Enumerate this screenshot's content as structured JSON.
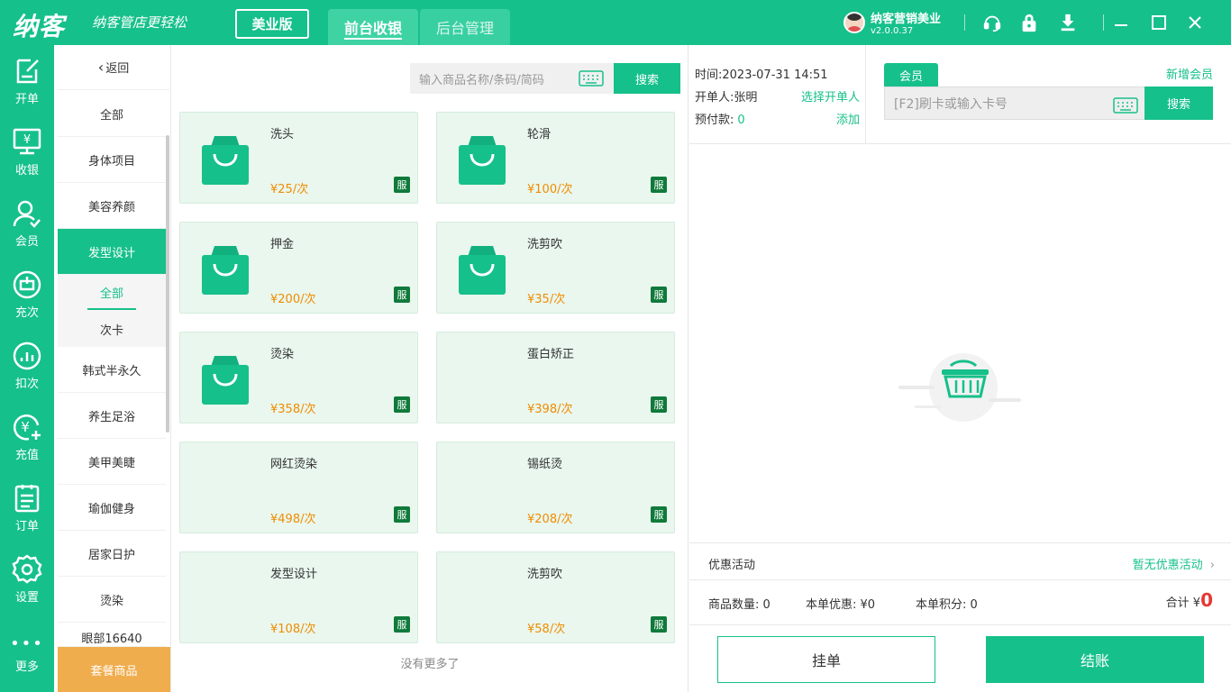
{
  "app": {
    "logo": "纳客",
    "slogan": "纳客管店更轻松",
    "edition": "美业版",
    "tabs": [
      {
        "label": "前台收银",
        "active": true
      },
      {
        "label": "后台管理",
        "active": false
      }
    ],
    "user": {
      "name": "纳客营销美业",
      "version": "v2.0.0.37"
    },
    "accent": "#16c08a"
  },
  "nav": {
    "items": [
      {
        "label": "开单",
        "icon": "order-edit-icon",
        "active": true
      },
      {
        "label": "收银",
        "icon": "cashier-icon",
        "active": false
      },
      {
        "label": "会员",
        "icon": "member-icon",
        "active": false
      },
      {
        "label": "充次",
        "icon": "recharge-times-icon",
        "active": false
      },
      {
        "label": "扣次",
        "icon": "deduct-times-icon",
        "active": false
      },
      {
        "label": "充值",
        "icon": "recharge-money-icon",
        "active": false
      },
      {
        "label": "订单",
        "icon": "orders-icon",
        "active": false
      },
      {
        "label": "设置",
        "icon": "settings-icon",
        "active": false
      },
      {
        "label": "更多",
        "icon": "more-icon",
        "active": false
      }
    ]
  },
  "categories": {
    "back_label": "返回",
    "items": [
      "全部",
      "身体项目",
      "美容养颜",
      "发型设计"
    ],
    "active": "发型设计",
    "sub_items": [
      "全部",
      "次卡"
    ],
    "sub_active": "全部",
    "items_after": [
      "韩式半永久",
      "养生足浴",
      "美甲美睫",
      "瑜伽健身",
      "居家日护",
      "烫染",
      "眼部16640"
    ],
    "package_label": "套餐商品"
  },
  "search": {
    "placeholder": "输入商品名称/条码/简码",
    "button": "搜索"
  },
  "products": [
    {
      "name": "洗头",
      "price": "¥25/次",
      "tag": "服",
      "has_image": true
    },
    {
      "name": "轮滑",
      "price": "¥100/次",
      "tag": "服",
      "has_image": true
    },
    {
      "name": "押金",
      "price": "¥200/次",
      "tag": "服",
      "has_image": true
    },
    {
      "name": "洗剪吹",
      "price": "¥35/次",
      "tag": "服",
      "has_image": true
    },
    {
      "name": "烫染",
      "price": "¥358/次",
      "tag": "服",
      "has_image": true
    },
    {
      "name": "蛋白矫正",
      "price": "¥398/次",
      "tag": "服",
      "has_image": false
    },
    {
      "name": "网红烫染",
      "price": "¥498/次",
      "tag": "服",
      "has_image": false
    },
    {
      "name": "锡纸烫",
      "price": "¥208/次",
      "tag": "服",
      "has_image": false
    },
    {
      "name": "发型设计",
      "price": "¥108/次",
      "tag": "服",
      "has_image": false
    },
    {
      "name": "洗剪吹",
      "price": "¥58/次",
      "tag": "服",
      "has_image": false
    }
  ],
  "no_more": "没有更多了",
  "order_info": {
    "time_label": "时间:",
    "time": "2023-07-31 14:51",
    "opener_label": "开单人:",
    "opener": "张明",
    "opener_link": "选择开单人",
    "prepay_label": "预付款:",
    "prepay": "0",
    "prepay_link": "添加"
  },
  "member": {
    "tab": "会员",
    "new_link": "新增会员",
    "placeholder": "[F2]刷卡或输入卡号",
    "button": "搜索"
  },
  "promo": {
    "label": "优惠活动",
    "value": "暂无优惠活动"
  },
  "summary": {
    "qty_label": "商品数量:",
    "qty": "0",
    "discount_label": "本单优惠:",
    "discount": "¥0",
    "points_label": "本单积分:",
    "points": "0",
    "total_label": "合计 ¥",
    "total": "0"
  },
  "actions": {
    "hold": "挂单",
    "pay": "结账"
  }
}
